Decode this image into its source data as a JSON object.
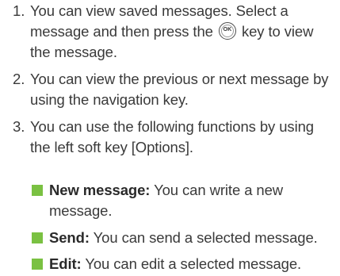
{
  "steps": [
    {
      "number": "1.",
      "text_before": "You can view saved messages. Select a message and then press the",
      "key_icon_label": "OK",
      "text_after": "key to view the message."
    },
    {
      "number": "2.",
      "text": "You can view the previous or next message by using the navigation key."
    },
    {
      "number": "3.",
      "text": "You can use the following functions by using the left soft key [Options]."
    }
  ],
  "functions": [
    {
      "term": "New message:",
      "description": "You can write a new message."
    },
    {
      "term": "Send:",
      "description": "You can send a selected message."
    },
    {
      "term": "Edit:",
      "description": "You can edit a selected message."
    }
  ],
  "colors": {
    "text": "#3a3a3a",
    "bullet": "#7ac142"
  }
}
